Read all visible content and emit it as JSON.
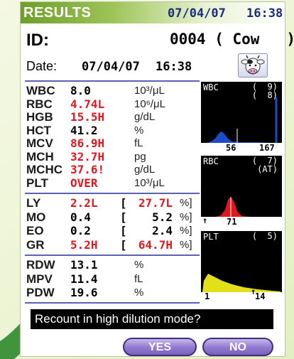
{
  "header": {
    "title": "RESULTS",
    "date": "07/04/07",
    "time": "16:38"
  },
  "id_row": {
    "label": "ID:",
    "value": "0004 ( Cow   )"
  },
  "date_row": {
    "label": "Date:",
    "date": "07/04/07",
    "time": "16:38"
  },
  "icons": {
    "species": "cow-icon"
  },
  "colors": {
    "header_green": "#9dc457",
    "normal_text": "#000000",
    "flag_red": "#e0171f",
    "button_purple": "#8f78cf"
  },
  "group1": [
    {
      "name": "WBC",
      "value": "8.0",
      "unit": "10³/μL",
      "flag": false
    },
    {
      "name": "RBC",
      "value": "4.74L",
      "unit": "10⁶/μL",
      "flag": true
    },
    {
      "name": "HGB",
      "value": "15.5H",
      "unit": "g/dL",
      "flag": true
    },
    {
      "name": "HCT",
      "value": "41.2",
      "unit": "%",
      "flag": false
    },
    {
      "name": "MCV",
      "value": "86.9H",
      "unit": "fL",
      "flag": true
    },
    {
      "name": "MCH",
      "value": "32.7H",
      "unit": "pg",
      "flag": true
    },
    {
      "name": "MCHC",
      "value": "37.6!",
      "unit": "g/dL",
      "flag": true
    },
    {
      "name": "PLT",
      "value": "OVER",
      "unit": "10³/μL",
      "flag": true
    }
  ],
  "group2": [
    {
      "name": "LY",
      "value": "2.2L",
      "pct": "27.7L",
      "flag": true,
      "pct_flag": true
    },
    {
      "name": "MO",
      "value": "0.4",
      "pct": "5.2",
      "flag": false,
      "pct_flag": false
    },
    {
      "name": "EO",
      "value": "0.2",
      "pct": "2.4",
      "flag": false,
      "pct_flag": false
    },
    {
      "name": "GR",
      "value": "5.2H",
      "pct": "64.7H",
      "flag": true,
      "pct_flag": true
    }
  ],
  "group2_symbols": {
    "open": "[",
    "close": "%]"
  },
  "group3": [
    {
      "name": "RDW",
      "value": "13.1",
      "unit": "%"
    },
    {
      "name": "MPV",
      "value": "11.4",
      "unit": "fL"
    },
    {
      "name": "PDW",
      "value": "19.6",
      "unit": "%"
    }
  ],
  "histograms": {
    "wbc": {
      "label": "WBC",
      "count": "(  9)\n(  8)",
      "axis": [
        "56",
        "167"
      ]
    },
    "rbc": {
      "label": "RBC",
      "count": "(  7)\n(AT)",
      "axis": [
        "71"
      ]
    },
    "plt": {
      "label": "PLT",
      "count": "(  5)",
      "axis": [
        "1",
        "14"
      ]
    }
  },
  "prompt": "Recount in high dilution mode?",
  "buttons": {
    "yes": "YES",
    "no": "NO"
  }
}
